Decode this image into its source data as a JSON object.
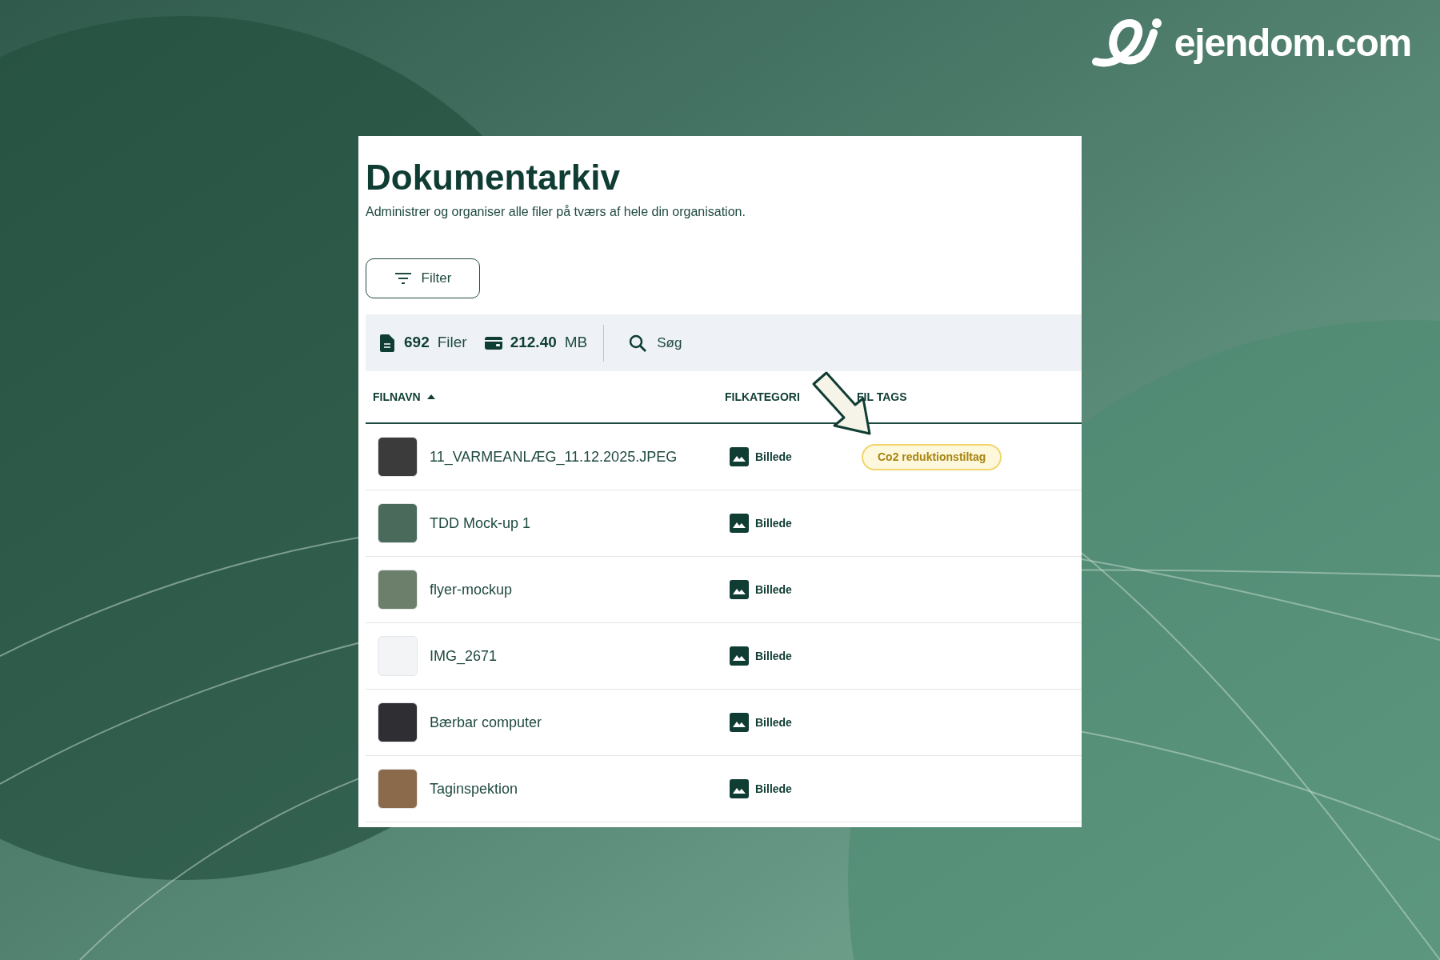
{
  "brand": {
    "name": "ejendom.com"
  },
  "page": {
    "title": "Dokumentarkiv",
    "subtitle": "Administrer og organiser alle filer på tværs af hele din organisation."
  },
  "filter_button": {
    "label": "Filter"
  },
  "stats": {
    "files_count": "692",
    "files_label": "Filer",
    "size_value": "212.40",
    "size_unit": "MB"
  },
  "search": {
    "placeholder": "Søg"
  },
  "table": {
    "columns": [
      {
        "label": "FILNAVN",
        "sorted": true
      },
      {
        "label": "FILKATEGORI",
        "sorted": false
      },
      {
        "label": "FIL TAGS",
        "sorted": false
      }
    ],
    "rows": [
      {
        "name": "11_VARMEANLÆG_11.12.2025.JPEG",
        "category": "Billede",
        "tags": [
          "Co2 reduktionstiltag"
        ]
      },
      {
        "name": "TDD Mock-up 1",
        "category": "Billede",
        "tags": []
      },
      {
        "name": "flyer-mockup",
        "category": "Billede",
        "tags": []
      },
      {
        "name": "IMG_2671",
        "category": "Billede",
        "tags": []
      },
      {
        "name": "Bærbar computer",
        "category": "Billede",
        "tags": []
      },
      {
        "name": "Taginspektion",
        "category": "Billede",
        "tags": []
      }
    ]
  }
}
